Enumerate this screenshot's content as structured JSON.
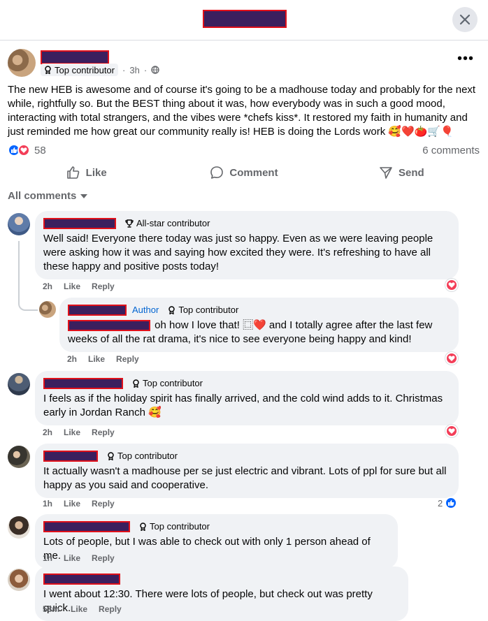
{
  "header": {
    "title_redacted": true
  },
  "post": {
    "badge": "Top contributor",
    "time": "3h",
    "body": "The new HEB is awesome and of course it's going to be a madhouse today and probably for the next while, rightfully so. But the BEST thing about it was, how everybody was in such a good mood, interacting with total strangers, and the vibes were *chefs kiss*. It restored my faith in humanity and just reminded me how great our community really is! HEB is doing the Lords work 🥰❤️🍅🛒🎈",
    "reaction_count": "58",
    "comments_count": "6 comments",
    "actions": {
      "like": "Like",
      "comment": "Comment",
      "send": "Send"
    }
  },
  "comments_sort": "All comments",
  "comments": [
    {
      "badge": "All-star contributor",
      "text": "Well said! Everyone there today was just so happy. Even as we were leaving people were asking how it was and saying how excited they were. It's refreshing to have all these happy and positive posts today!",
      "time": "2h",
      "like": "Like",
      "reply": "Reply"
    },
    {
      "author_label": "Author",
      "badge": "Top contributor",
      "text": "oh how I love that! ⿴❤️ and I totally agree after the last few weeks of all the rat drama, it's nice to see everyone being happy and kind!",
      "time": "2h",
      "like": "Like",
      "reply": "Reply"
    },
    {
      "badge": "Top contributor",
      "text": "I feels as if the holiday spirit has finally arrived, and the cold wind adds to it. Christmas early in Jordan Ranch 🥰",
      "time": "2h",
      "like": "Like",
      "reply": "Reply"
    },
    {
      "badge": "Top contributor",
      "text": "It actually wasn't a madhouse per se just electric and vibrant. Lots of ppl for sure but all happy as you said and cooperative.",
      "time": "1h",
      "like": "Like",
      "reply": "Reply",
      "like_count": "2"
    },
    {
      "badge": "Top contributor",
      "text": "Lots of people, but I was able to check out with only 1 person ahead of me.",
      "time": "1h",
      "like": "Like",
      "reply": "Reply"
    },
    {
      "text": "I went about 12:30. There were lots of people, but check out was pretty quick.",
      "time": "58m",
      "like": "Like",
      "reply": "Reply"
    }
  ],
  "colors": {
    "accent_blue": "#0866ff",
    "heart_red": "#f33e58",
    "bubble_bg": "#f0f2f5",
    "redaction_fill": "#3b1f5e",
    "redaction_border": "#e0101a"
  },
  "icons": [
    "close-icon",
    "more-icon",
    "globe-icon",
    "badge-icon",
    "trophy-icon",
    "like-icon",
    "comment-icon",
    "send-icon",
    "chevron-down-icon",
    "heart-icon"
  ]
}
